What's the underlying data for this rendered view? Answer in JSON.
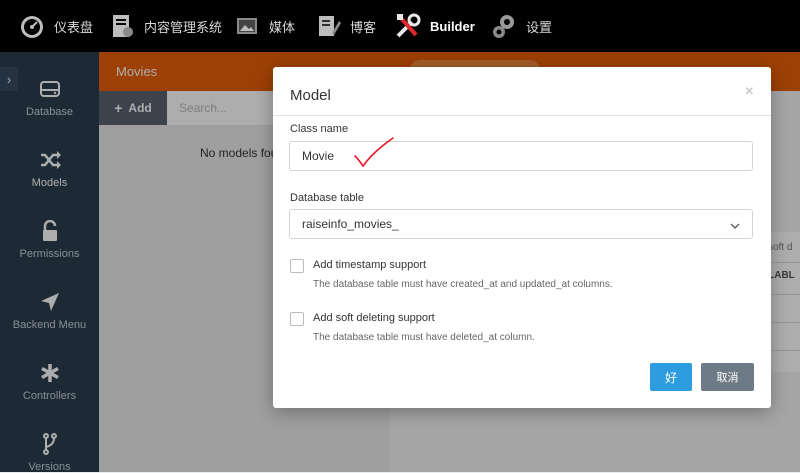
{
  "topnav": {
    "items": [
      {
        "label": "仪表盘",
        "icon": "dashboard-icon"
      },
      {
        "label": "内容管理系统",
        "icon": "cms-icon"
      },
      {
        "label": "媒体",
        "icon": "media-icon"
      },
      {
        "label": "博客",
        "icon": "blog-icon"
      },
      {
        "label": "Builder",
        "icon": "builder-tools-icon",
        "active": true
      },
      {
        "label": "设置",
        "icon": "settings-gears-icon"
      }
    ]
  },
  "sidebar": {
    "toggle": "›",
    "items": [
      {
        "label": "Database",
        "icon": "database-icon"
      },
      {
        "label": "Models",
        "icon": "shuffle-icon",
        "active": true
      },
      {
        "label": "Permissions",
        "icon": "lock-icon"
      },
      {
        "label": "Backend Menu",
        "icon": "location-arrow-icon"
      },
      {
        "label": "Controllers",
        "icon": "asterisk-icon"
      },
      {
        "label": "Versions",
        "icon": "branch-icon"
      }
    ]
  },
  "panel": {
    "title": "Movies",
    "add_label": "Add",
    "search_placeholder": "Search...",
    "empty_text": "No models fou"
  },
  "background_table": {
    "header1": "soft d",
    "header2": "LLABL"
  },
  "modal": {
    "title": "Model",
    "close": "×",
    "class_name_label": "Class name",
    "class_name_value": "Movie",
    "db_table_label": "Database table",
    "db_table_value": "raiseinfo_movies_",
    "timestamp_label": "Add timestamp support",
    "timestamp_help": "The database table must have created_at and updated_at columns.",
    "soft_delete_label": "Add soft deleting support",
    "soft_delete_help": "The database table must have deleted_at column.",
    "ok_label": "好",
    "cancel_label": "取消"
  },
  "colors": {
    "brand_orange": "#e85f09",
    "sidebar": "#2b3e50",
    "primary_button": "#2d9de0",
    "annotation": "#e3192b"
  }
}
